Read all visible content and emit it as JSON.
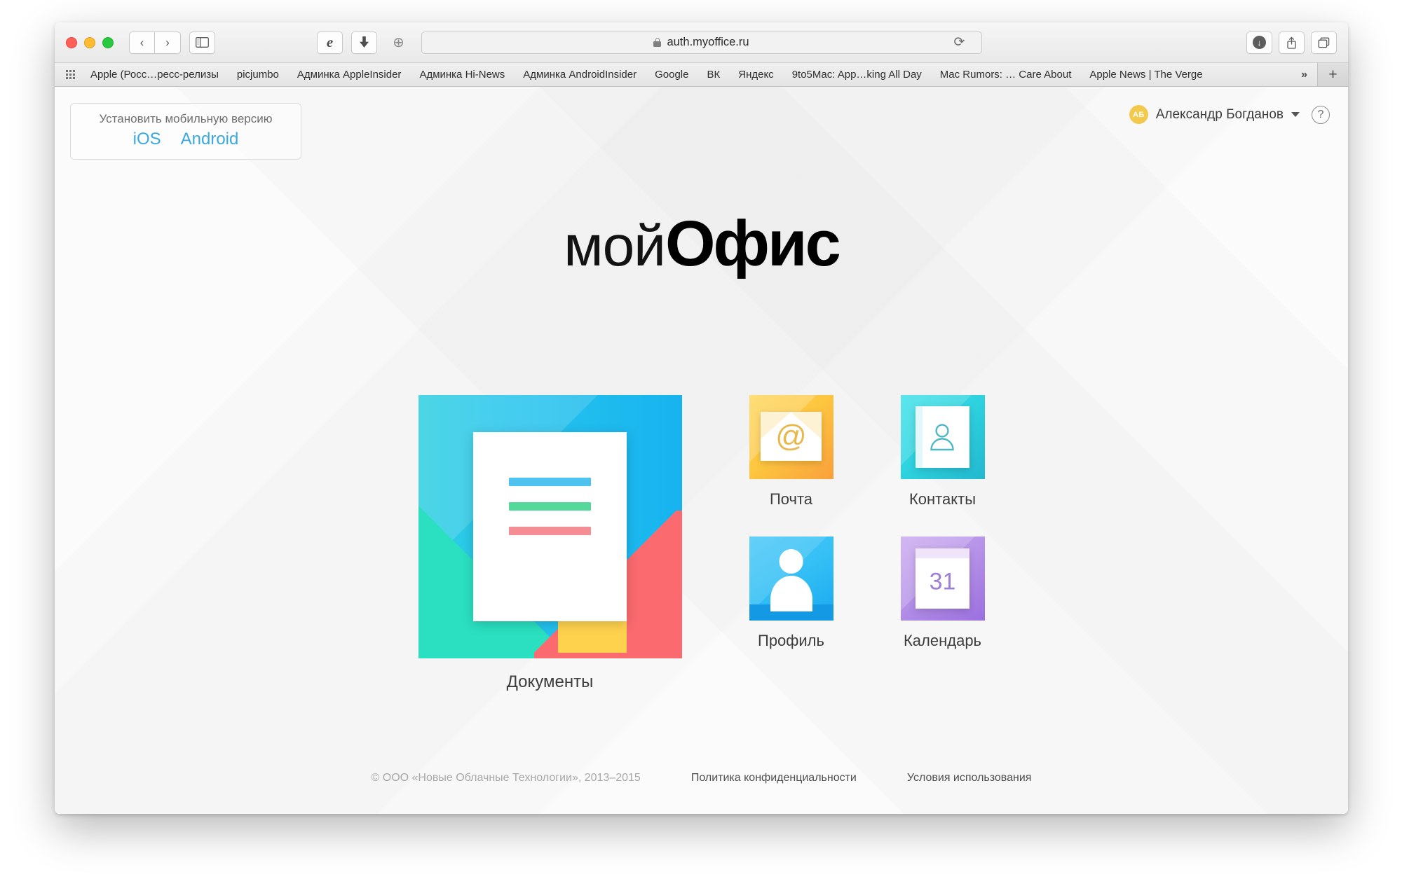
{
  "browser": {
    "traffic_lights": [
      "close",
      "minimize",
      "zoom"
    ],
    "back_label": "‹",
    "forward_label": "›",
    "sidebar_icon": "sidebar-icon",
    "ie_icon_label": "e",
    "download_arrow_icon": "download-arrow-icon",
    "add_icon": "⊕",
    "url": "auth.myoffice.ru",
    "reload_label": "⟳",
    "downloads_label": "↓",
    "share_label": "share-icon",
    "tabs_label": "tabs-icon"
  },
  "bookmarks": {
    "apps_grid_icon": "apps-grid-icon",
    "items": [
      {
        "label": "Apple (Росс…ресс-релизы"
      },
      {
        "label": "picjumbo"
      },
      {
        "label": "Админка AppleInsider"
      },
      {
        "label": "Админка Hi-News"
      },
      {
        "label": "Админка AndroidInsider"
      },
      {
        "label": "Google"
      },
      {
        "label": "ВК"
      },
      {
        "label": "Яндекс"
      },
      {
        "label": "9to5Mac: App…king All Day"
      },
      {
        "label": "Mac Rumors: … Care About"
      },
      {
        "label": "Apple News | The Verge"
      }
    ],
    "overflow_label": "»",
    "newtab_label": "+"
  },
  "install": {
    "title": "Установить мобильную версию",
    "ios_label": "iOS",
    "android_label": "Android"
  },
  "user": {
    "initials": "АБ",
    "name": "Александр Богданов",
    "caret": "▾",
    "help_label": "?",
    "avatar_color": "#f2c94c"
  },
  "logo": {
    "thin": "мой",
    "bold": "Офис"
  },
  "apps": {
    "documents": {
      "label": "Документы",
      "icon": "documents-icon"
    },
    "mail": {
      "label": "Почта",
      "icon": "mail-icon",
      "glyph": "@"
    },
    "contacts": {
      "label": "Контакты",
      "icon": "contacts-icon"
    },
    "profile": {
      "label": "Профиль",
      "icon": "profile-icon"
    },
    "calendar": {
      "label": "Календарь",
      "icon": "calendar-icon",
      "day": "31"
    }
  },
  "footer": {
    "copyright": "© ООО «Новые Облачные Технологии», 2013–2015",
    "privacy_label": "Политика конфиденциальности",
    "terms_label": "Условия использования"
  },
  "colors": {
    "accent_blue": "#3aa9e0",
    "documents_blue": "#17b3f0",
    "mail_yellow": "#fdc63f",
    "contacts_cyan": "#2fd4e0",
    "profile_blue": "#33bff5",
    "calendar_purple": "#b794e8"
  }
}
